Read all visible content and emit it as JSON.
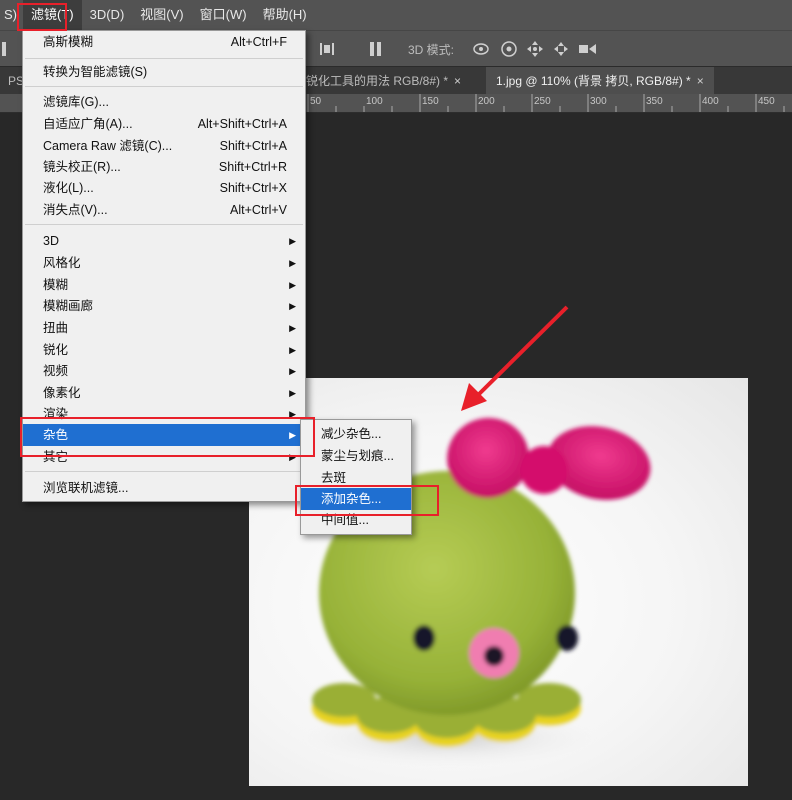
{
  "menubar": {
    "items": [
      {
        "label": "S)",
        "active": false
      },
      {
        "label": "滤镜(T)",
        "active": true
      },
      {
        "label": "3D(D)",
        "active": false
      },
      {
        "label": "视图(V)",
        "active": false
      },
      {
        "label": "窗口(W)",
        "active": false
      },
      {
        "label": "帮助(H)",
        "active": false
      }
    ]
  },
  "options_bar": {
    "mode_label": "3D 模式:"
  },
  "tabs": [
    {
      "label": "PS",
      "close": ""
    },
    {
      "label": "锐化工具的用法 RGB/8#) *",
      "close": "×"
    },
    {
      "label": "1.jpg @ 110% (背景 拷贝, RGB/8#) *",
      "close": "×"
    }
  ],
  "ruler": {
    "labels": [
      "50",
      "100",
      "150",
      "200",
      "250",
      "300",
      "350",
      "400",
      "450"
    ]
  },
  "filter_menu": {
    "items": [
      {
        "label": "高斯模糊",
        "shortcut": "Alt+Ctrl+F"
      },
      {
        "label": "转换为智能滤镜(S)",
        "shortcut": ""
      },
      {
        "label": "滤镜库(G)...",
        "shortcut": ""
      },
      {
        "label": "自适应广角(A)...",
        "shortcut": "Alt+Shift+Ctrl+A"
      },
      {
        "label": "Camera Raw 滤镜(C)...",
        "shortcut": "Shift+Ctrl+A"
      },
      {
        "label": "镜头校正(R)...",
        "shortcut": "Shift+Ctrl+R"
      },
      {
        "label": "液化(L)...",
        "shortcut": "Shift+Ctrl+X"
      },
      {
        "label": "消失点(V)...",
        "shortcut": "Alt+Ctrl+V"
      },
      {
        "label": "3D",
        "shortcut": ""
      },
      {
        "label": "风格化",
        "shortcut": ""
      },
      {
        "label": "模糊",
        "shortcut": ""
      },
      {
        "label": "模糊画廊",
        "shortcut": ""
      },
      {
        "label": "扭曲",
        "shortcut": ""
      },
      {
        "label": "锐化",
        "shortcut": ""
      },
      {
        "label": "视频",
        "shortcut": ""
      },
      {
        "label": "像素化",
        "shortcut": ""
      },
      {
        "label": "渲染",
        "shortcut": ""
      },
      {
        "label": "杂色",
        "shortcut": ""
      },
      {
        "label": "其它",
        "shortcut": ""
      },
      {
        "label": "浏览联机滤镜...",
        "shortcut": ""
      }
    ],
    "arrow": "▶"
  },
  "noise_submenu": {
    "items": [
      {
        "label": "减少杂色..."
      },
      {
        "label": "蒙尘与划痕..."
      },
      {
        "label": "去斑"
      },
      {
        "label": "添加杂色..."
      },
      {
        "label": "中间值..."
      }
    ]
  },
  "colors": {
    "highlight": "#1f6fd1",
    "annotation_red": "#e8202a",
    "toy_green": "#9db83c",
    "bow_pink": "#e8137a"
  }
}
